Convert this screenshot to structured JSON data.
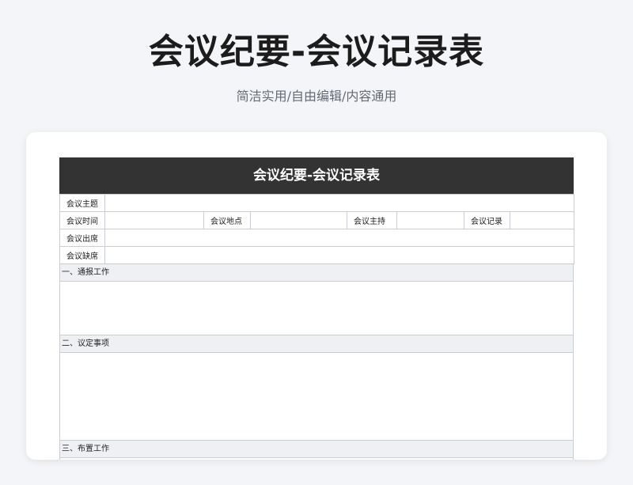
{
  "header": {
    "title": "会议纪要-会议记录表",
    "subtitle": "简洁实用/自由编辑/内容通用"
  },
  "sheet": {
    "title": "会议纪要-会议记录表",
    "fields": {
      "topic_label": "会议主题",
      "time_label": "会议时间",
      "location_label": "会议地点",
      "host_label": "会议主持",
      "recorder_label": "会议记录",
      "attendees_label": "会议出席",
      "absentees_label": "会议缺席"
    },
    "sections": [
      {
        "label": "一、通报工作"
      },
      {
        "label": "二、议定事项"
      },
      {
        "label": "三、布置工作"
      }
    ]
  }
}
